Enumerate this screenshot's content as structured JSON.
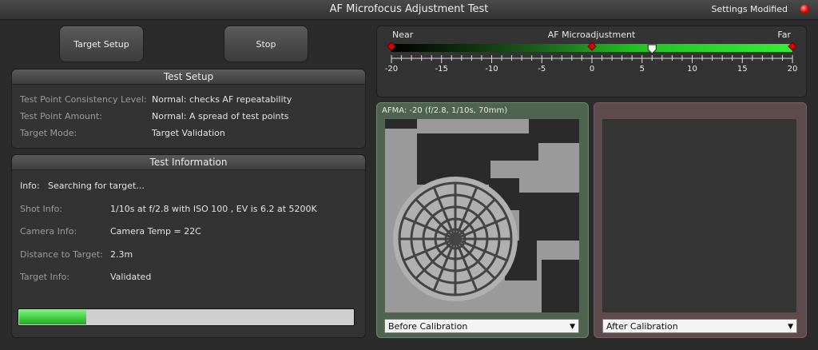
{
  "window": {
    "title": "AF Microfocus Adjustment Test",
    "settings_modified": "Settings Modified",
    "status_color": "#e00000"
  },
  "toolbar": {
    "target_setup_label": "Target Setup",
    "stop_label": "Stop"
  },
  "test_setup": {
    "header": "Test Setup",
    "rows": [
      {
        "label": "Test Point Consistency Level:",
        "value": "Normal: checks AF repeatability"
      },
      {
        "label": "Test Point Amount:",
        "value": "Normal: A spread of test points"
      },
      {
        "label": "Target Mode:",
        "value": "Target Validation"
      }
    ]
  },
  "test_info": {
    "header": "Test Information",
    "info_label": "Info:",
    "info_value": "Searching for target...",
    "rows": [
      {
        "label": "Shot Info:",
        "value": "1/10s at f/2.8 with ISO 100 , EV is 6.2 at 5200K"
      },
      {
        "label": "Camera Info:",
        "value": "Camera Temp = 22C"
      },
      {
        "label": "Distance to Target:",
        "value": "2.3m"
      },
      {
        "label": "Target Info:",
        "value": "Validated"
      }
    ],
    "progress_fraction": 0.2
  },
  "afma_scale": {
    "near_label": "Near",
    "title": "AF Microadjustment",
    "far_label": "Far",
    "min": -20,
    "max": 20,
    "tick_labels": [
      "-20",
      "-15",
      "-10",
      "-5",
      "0",
      "5",
      "10",
      "15",
      "20"
    ],
    "red_markers": [
      -20,
      0,
      20
    ],
    "current_value": 6,
    "accent": "#22cc22"
  },
  "before_panel": {
    "caption": "AFMA: -20 (f/2.8, 1/10s, 70mm)",
    "select_value": "Before Calibration",
    "border_color": "#5f7f5f"
  },
  "after_panel": {
    "select_value": "After Calibration",
    "border_color": "#7a5a5a"
  }
}
